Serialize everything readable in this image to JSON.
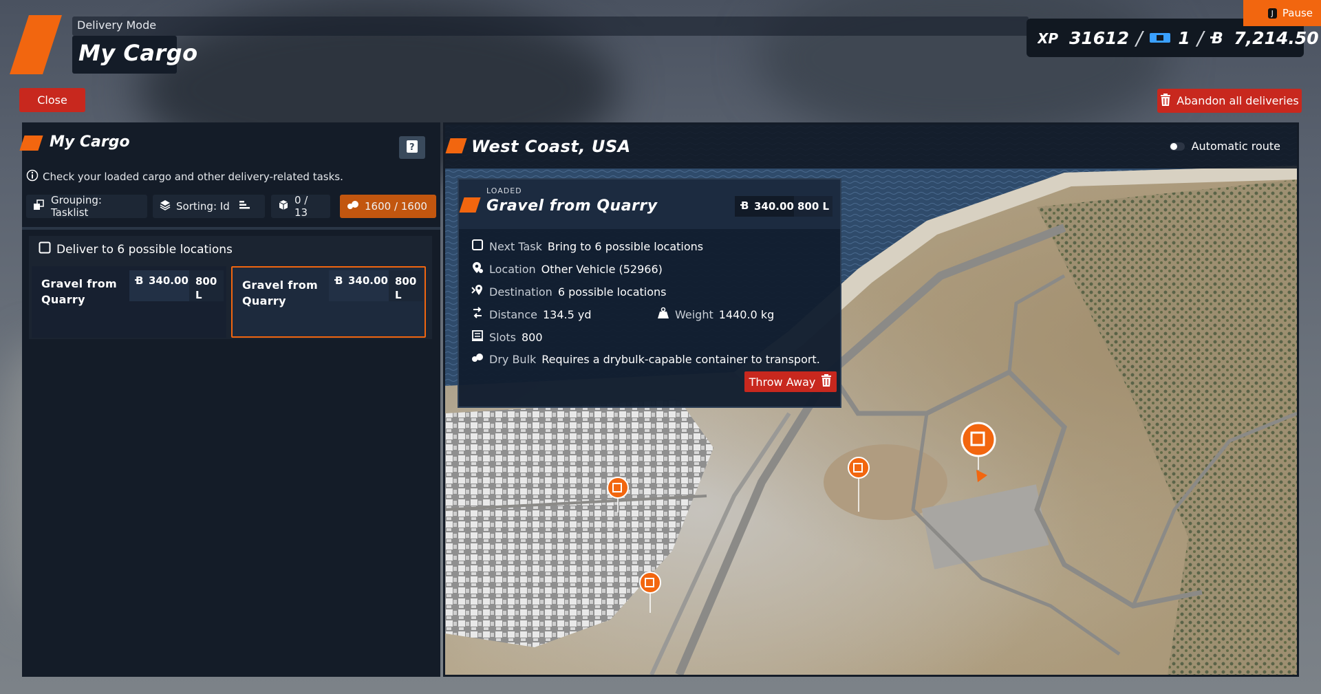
{
  "header": {
    "mode_label": "Delivery Mode",
    "title": "My Cargo",
    "close_label": "Close",
    "pause_key": "J",
    "pause_label": "Pause",
    "abandon_label": "Abandon all deliveries",
    "stats": {
      "xp": "31612",
      "tickets": "1",
      "money": "7,214.50"
    }
  },
  "cargo_panel": {
    "title": "My Cargo",
    "info": "Check your loaded cargo and other delivery-related tasks.",
    "grouping": "Grouping: Tasklist",
    "sorting": "Sorting: Id",
    "count": "0 / 13",
    "capacity": "1600 / 1600",
    "group": {
      "header": "Deliver to 6 possible locations",
      "cards": [
        {
          "name": "Gravel from Quarry",
          "price": "340.00",
          "volume": "800 L",
          "selected": false
        },
        {
          "name": "Gravel from Quarry",
          "price": "340.00",
          "volume": "800 L",
          "selected": true
        }
      ]
    }
  },
  "map": {
    "region": "West Coast, USA",
    "automatic_route": "Automatic route",
    "detail": {
      "status": "LOADED",
      "name": "Gravel from Quarry",
      "price": "340.00",
      "volume": "800 L",
      "next_task_key": "Next Task",
      "next_task": "Bring to 6 possible locations",
      "location_key": "Location",
      "location": "Other Vehicle (52966)",
      "destination_key": "Destination",
      "destination": "6 possible locations",
      "distance_key": "Distance",
      "distance": "134.5 yd",
      "weight_key": "Weight",
      "weight": "1440.0 kg",
      "slots_key": "Slots",
      "slots": "800",
      "type_key": "Dry Bulk",
      "type_desc": "Requires a drybulk-capable container to transport.",
      "throw_label": "Throw Away"
    }
  },
  "colors": {
    "accent": "#f2660f",
    "danger": "#c8281e",
    "panel": "#141c28"
  }
}
